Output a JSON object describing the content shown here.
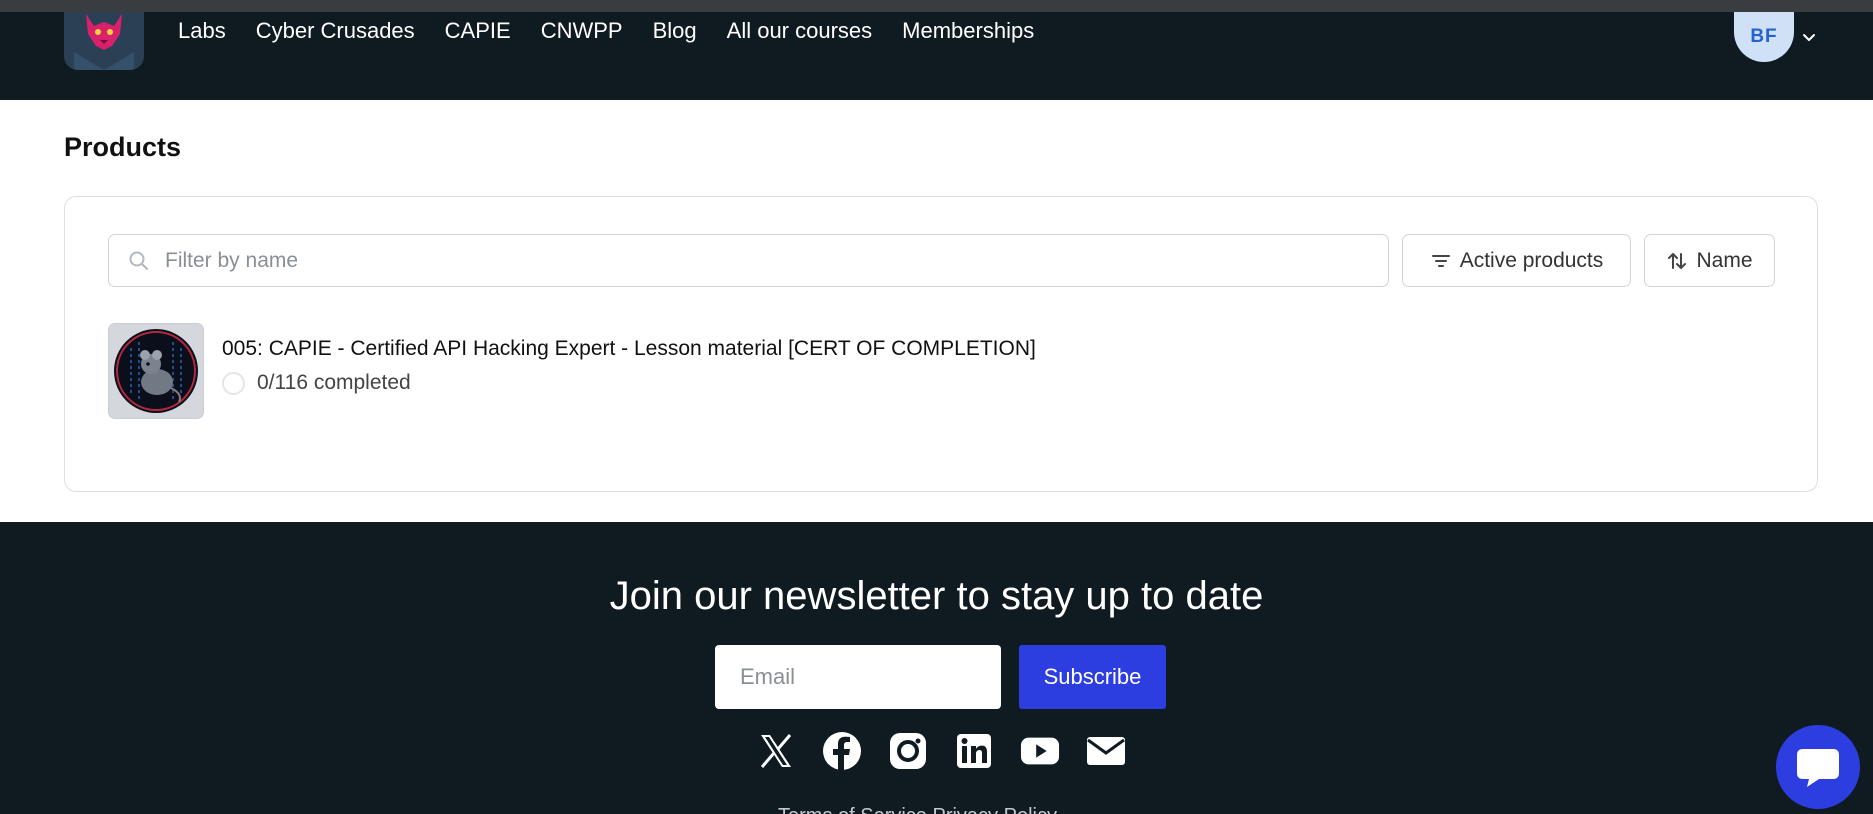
{
  "header": {
    "nav": [
      "Labs",
      "Cyber Crusades",
      "CAPIE",
      "CNWPP",
      "Blog",
      "All our courses",
      "Memberships"
    ],
    "avatar_initials": "BF"
  },
  "page_title": "Products",
  "filters": {
    "search_placeholder": "Filter by name",
    "status_label": "Active products",
    "sort_label": "Name"
  },
  "products": [
    {
      "title": "005: CAPIE - Certified API Hacking Expert - Lesson material [CERT OF COMPLETION]",
      "progress_text": "0/116 completed",
      "completed_fraction": 0
    }
  ],
  "footer": {
    "newsletter_title": "Join our newsletter to stay up to date",
    "email_placeholder": "Email",
    "subscribe_label": "Subscribe",
    "socials": [
      "x-icon",
      "facebook-icon",
      "instagram-icon",
      "linkedin-icon",
      "youtube-icon",
      "mail-icon"
    ],
    "legal_text": "Terms of Service   Privacy Policy"
  },
  "colors": {
    "dark_bg": "#0f1a21",
    "accent": "#2d3ee0",
    "avatar_bg": "#cfe0f7"
  }
}
